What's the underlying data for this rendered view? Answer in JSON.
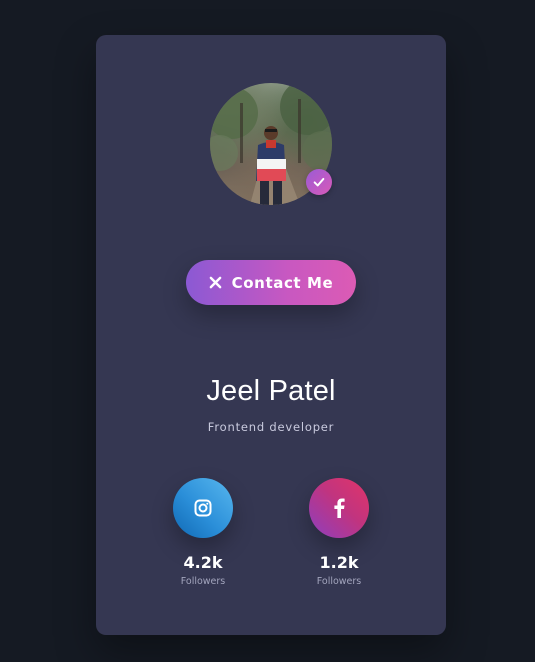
{
  "profile": {
    "name": "Jeel Patel",
    "role": "Frontend developer",
    "verified_icon": "check-icon"
  },
  "contact": {
    "label": "Contact Me",
    "icon": "close-icon"
  },
  "social": [
    {
      "network": "instagram",
      "icon": "instagram-icon",
      "count": "4.2k",
      "label": "Followers"
    },
    {
      "network": "facebook",
      "icon": "facebook-icon",
      "count": "1.2k",
      "label": "Followers"
    }
  ],
  "colors": {
    "background": "#151a23",
    "card": "#353752",
    "accent_start": "#8b59d4",
    "accent_end": "#dc5bb4",
    "instagram_start": "#1069b4",
    "instagram_end": "#58b7ee",
    "facebook_start": "#8d3fc0",
    "facebook_end": "#e23468"
  }
}
